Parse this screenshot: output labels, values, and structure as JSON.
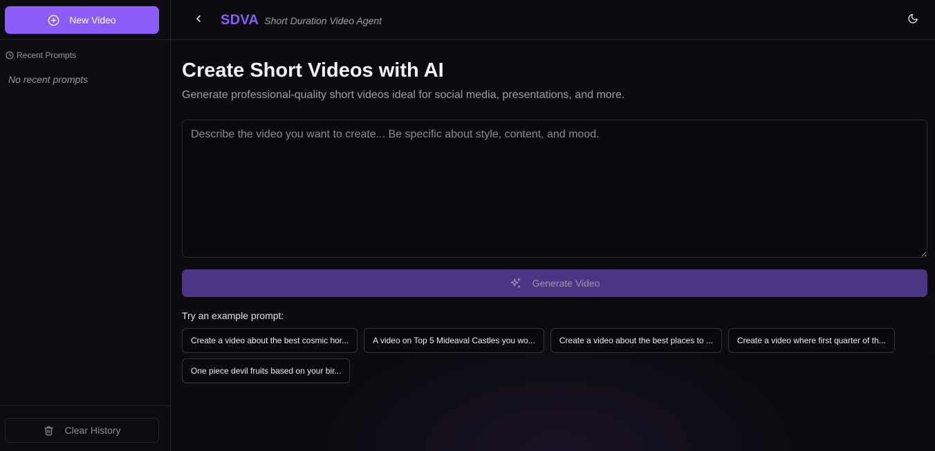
{
  "sidebar": {
    "new_video_label": "New Video",
    "recent_prompts_label": "Recent Prompts",
    "no_recent_label": "No recent prompts",
    "clear_history_label": "Clear History"
  },
  "header": {
    "brand_name": "SDVA",
    "brand_subtitle": "Short Duration Video Agent"
  },
  "main": {
    "title": "Create Short Videos with AI",
    "subtitle": "Generate professional-quality short videos ideal for social media, presentations, and more.",
    "prompt_placeholder": "Describe the video you want to create... Be specific about style, content, and mood.",
    "prompt_value": "",
    "generate_label": "Generate Video",
    "examples_label": "Try an example prompt:",
    "examples": [
      "Create a video about the best cosmic hor...",
      "A video on Top 5 Mideaval Castles you wo...",
      "Create a video about the best places to ...",
      "Create a video where first quarter of th...",
      "One piece devil fruits based on your bir..."
    ]
  },
  "colors": {
    "accent": "#8b5cf6",
    "generate_button_bg": "#4c3585",
    "background": "#0c0b10"
  },
  "icons": {
    "new_video": "plus-circle-icon",
    "recent": "clock-icon",
    "clear": "trash-icon",
    "back": "chevron-left-icon",
    "theme": "moon-icon",
    "generate": "sparkles-icon"
  }
}
